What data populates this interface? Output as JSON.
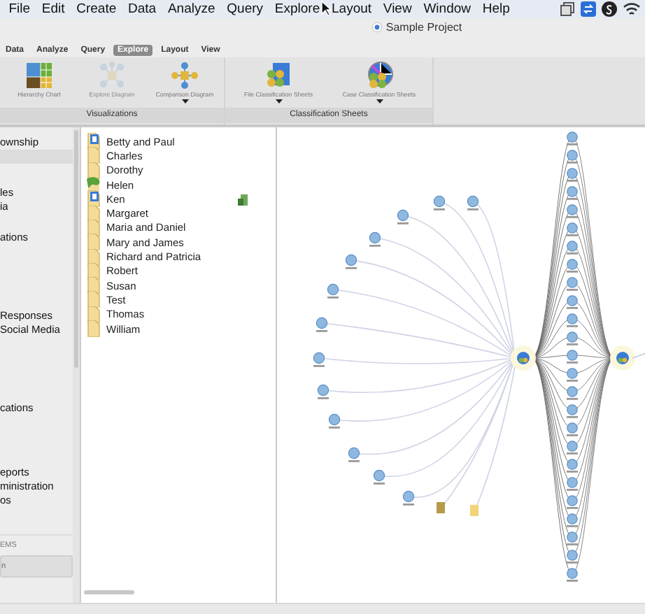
{
  "menu_bar": {
    "items": [
      "File",
      "Edit",
      "Create",
      "Data",
      "Analyze",
      "Query",
      "Explore",
      "Layout",
      "View",
      "Window",
      "Help"
    ]
  },
  "window": {
    "title": "Sample Project"
  },
  "ribbon": {
    "tabs": [
      {
        "label": "Data",
        "selected": false
      },
      {
        "label": "Analyze",
        "selected": false
      },
      {
        "label": "Query",
        "selected": false
      },
      {
        "label": "Explore",
        "selected": true
      },
      {
        "label": "Layout",
        "selected": false
      },
      {
        "label": "View",
        "selected": false
      }
    ],
    "groups": [
      {
        "label": "Visualizations",
        "buttons": [
          {
            "kind": "hierarchy",
            "label": "Hierarchy Chart",
            "disabled": false,
            "dropdown": false
          },
          {
            "kind": "explore",
            "label": "Explore Diagram",
            "disabled": true,
            "dropdown": false
          },
          {
            "kind": "comparison",
            "label": "Comparison Diagram",
            "disabled": false,
            "dropdown": true
          }
        ]
      },
      {
        "label": "Classification Sheets",
        "buttons": [
          {
            "kind": "file_sheet",
            "label": "File Classification Sheets",
            "disabled": false,
            "dropdown": true
          },
          {
            "kind": "case_sheet",
            "label": "Case Classification Sheets",
            "disabled": false,
            "dropdown": true
          }
        ]
      }
    ]
  },
  "sidebar": {
    "items": [
      {
        "label": "ownship",
        "selected": false
      },
      {
        "selected": true
      },
      {
        "label": "les",
        "selected": false
      },
      {
        "label": "ia",
        "selected": false
      },
      {
        "label": "ations",
        "selected": false
      },
      {
        "label": "Responses",
        "selected": false
      },
      {
        "label": "Social Media",
        "selected": false
      },
      {
        "label": "cations",
        "selected": false
      },
      {
        "label": "eports",
        "selected": false
      },
      {
        "label": "ministration",
        "selected": false
      },
      {
        "label": "os",
        "selected": false
      }
    ],
    "section_label": "EMS",
    "section_button": "n"
  },
  "file_list": {
    "items": [
      {
        "name": "Betty and Paul",
        "kind": "video"
      },
      {
        "name": "Charles",
        "kind": "document"
      },
      {
        "name": "Dorothy",
        "kind": "document"
      },
      {
        "name": "Helen",
        "kind": "image"
      },
      {
        "name": "Ken",
        "kind": "video",
        "flagged": true
      },
      {
        "name": "Margaret",
        "kind": "document"
      },
      {
        "name": "Maria and Daniel",
        "kind": "document"
      },
      {
        "name": "Mary and James",
        "kind": "document"
      },
      {
        "name": "Richard and Patricia",
        "kind": "document"
      },
      {
        "name": "Robert",
        "kind": "document"
      },
      {
        "name": "Susan",
        "kind": "document"
      },
      {
        "name": "Test",
        "kind": "document"
      },
      {
        "name": "Thomas",
        "kind": "document"
      },
      {
        "name": "William",
        "kind": "document"
      }
    ]
  }
}
